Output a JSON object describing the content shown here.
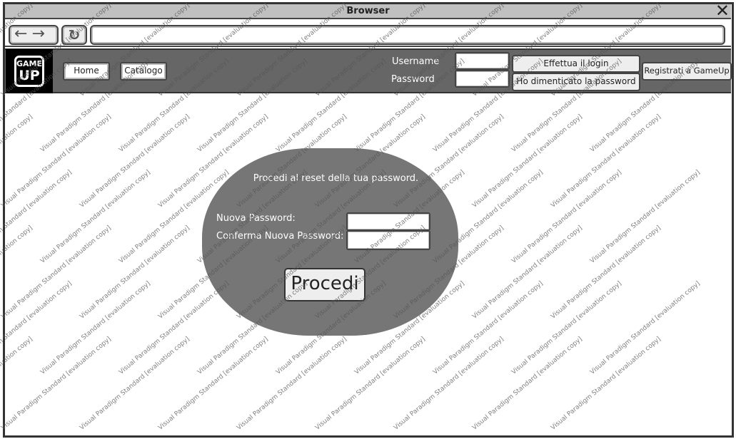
{
  "browser": {
    "title": "Browser",
    "close_icon": "close-x-icon",
    "back_icon": "arrow-left-icon",
    "forward_icon": "arrow-right-icon",
    "reload_icon": "reload-icon",
    "url_value": ""
  },
  "header": {
    "logo_text": "GAME UP",
    "logo_line1": "GAME",
    "logo_line2": "UP",
    "nav": [
      {
        "label": "Home"
      },
      {
        "label": "Catalogo"
      }
    ],
    "username_label": "Username",
    "password_label": "Password",
    "username_value": "",
    "password_value": "",
    "login_label": "Effettua il login",
    "forgot_label": "Ho dimenticato la password",
    "register_label": "Registrati a GameUp"
  },
  "reset": {
    "title": "Procedi al reset della tua password.",
    "new_password_label": "Nuova Password:",
    "confirm_password_label": "Conferma Nuova Password:",
    "new_password_value": "",
    "confirm_password_value": "",
    "submit_label": "Procedi"
  },
  "colors": {
    "header_bg": "#666666",
    "titlebar_bg": "#c0c0c0",
    "form_bg": "#767676"
  },
  "watermark": "Visual Paradigm Standard [evaluation copy]"
}
